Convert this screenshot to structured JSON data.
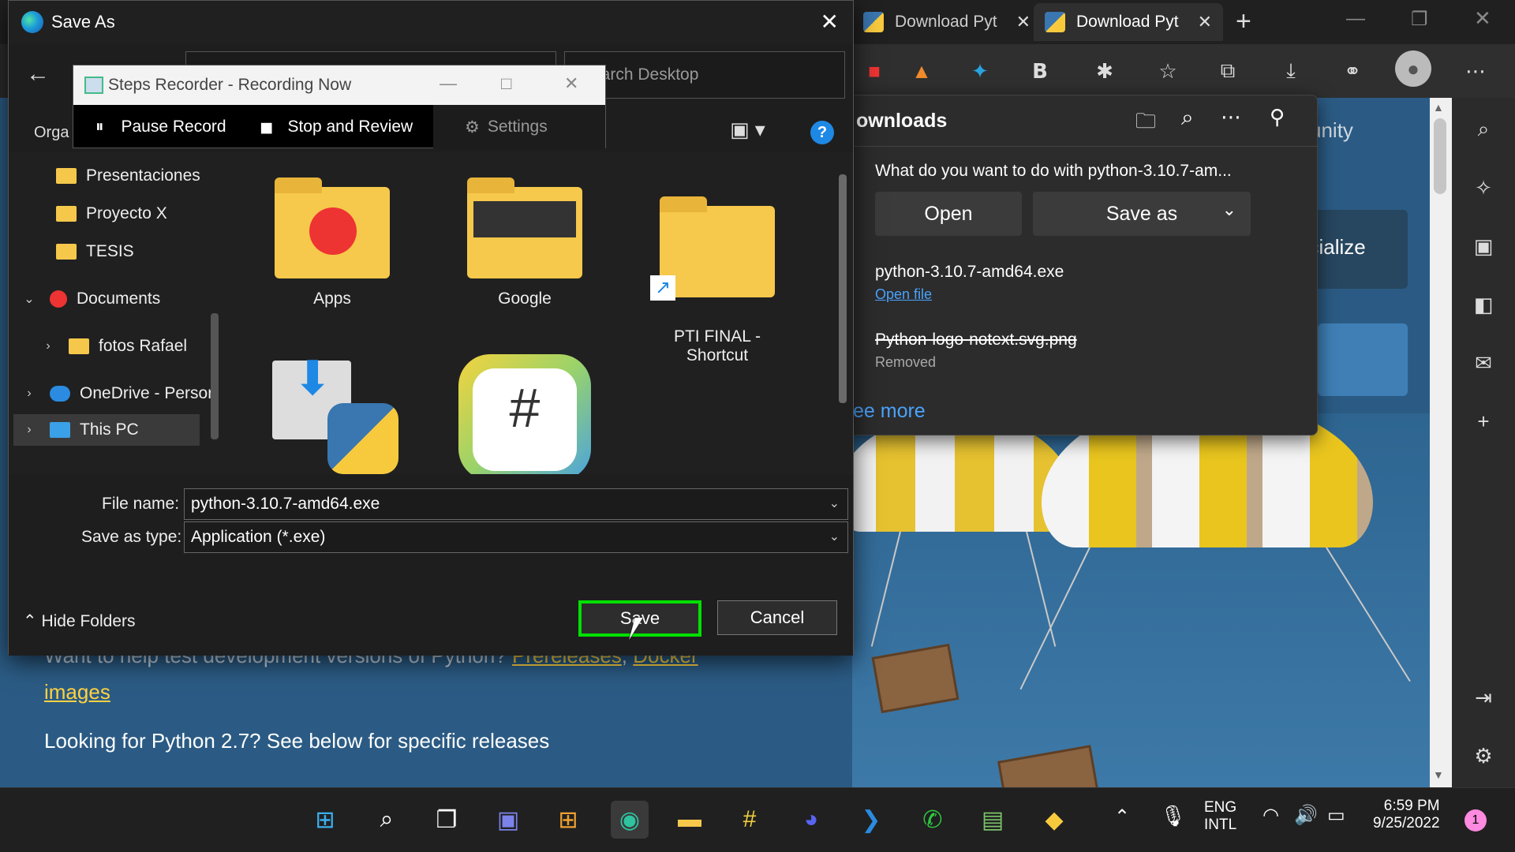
{
  "browser": {
    "tabs": [
      {
        "label": "Download Pyt"
      },
      {
        "label": "Download Pyt"
      }
    ],
    "new_tab": "+",
    "page_snippets": {
      "unity": "unity",
      "socialize": "ocialize"
    }
  },
  "downloads": {
    "title": "ownloads",
    "prompt": "What do you want to do with python-3.10.7-am...",
    "open_label": "Open",
    "save_as_label": "Save as",
    "items": [
      {
        "name": "python-3.10.7-amd64.exe",
        "sub": "Open file"
      },
      {
        "name": "Python-logo-notext.svg.png",
        "sub": "Removed"
      }
    ],
    "see_more": "ee more"
  },
  "dialog": {
    "title": "Save As",
    "search_placeholder": "Search Desktop",
    "organize": "Orga",
    "nav_items": [
      {
        "label": "Presentaciones"
      },
      {
        "label": "Proyecto X"
      },
      {
        "label": "TESIS"
      },
      {
        "label": "Documents"
      },
      {
        "label": "fotos Rafael"
      },
      {
        "label": "OneDrive - Persor"
      },
      {
        "label": "This PC"
      }
    ],
    "files": [
      {
        "label": "Apps"
      },
      {
        "label": "Google"
      },
      {
        "label": "PTI FINAL -\nShortcut"
      }
    ],
    "file_name_label": "File name:",
    "file_name_value": "python-3.10.7-amd64.exe",
    "save_type_label": "Save as type:",
    "save_type_value": "Application (*.exe)",
    "hide_folders": "Hide Folders",
    "save_label": "Save",
    "cancel_label": "Cancel"
  },
  "recorder": {
    "title": "Steps Recorder - Recording Now",
    "pause": "Pause Record",
    "stop": "Stop and Review",
    "settings": "Settings"
  },
  "page": {
    "line1": "Want to help test development versions of Python?",
    "link1": "Prereleases",
    "comma": ",",
    "link2": "Docker",
    "link3": "images",
    "line2": "Looking for Python 2.7? See below for specific releases"
  },
  "taskbar": {
    "lang1": "ENG",
    "lang2": "INTL",
    "time": "6:59 PM",
    "date": "9/25/2022",
    "notifications": "1"
  },
  "colors": {
    "accent_green": "#00e000",
    "link_yellow": "#ffd242",
    "page_blue": "#2b5b84"
  }
}
